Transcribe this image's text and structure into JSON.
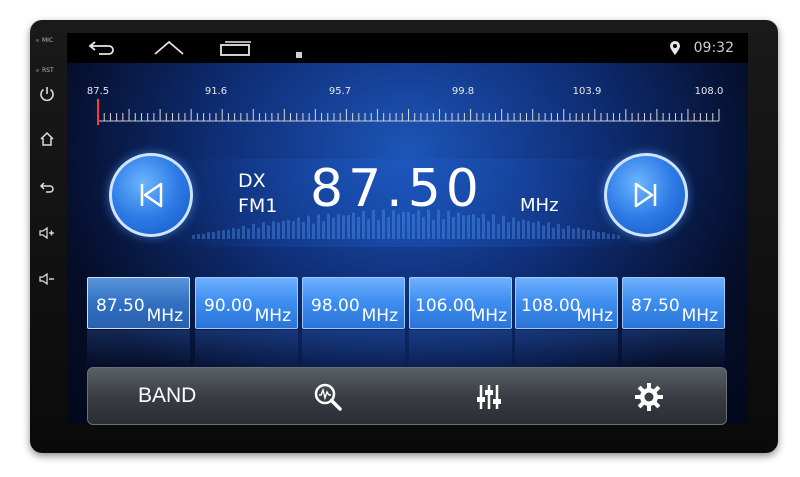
{
  "bezel": {
    "mic_label": "MIC",
    "rst_label": "RST"
  },
  "status_bar": {
    "time": "09:32",
    "icons": [
      "back-icon",
      "home-icon",
      "recent-apps-icon",
      "notification-icon",
      "location-icon"
    ]
  },
  "tuner_scale": {
    "labels": [
      "87.5",
      "91.6",
      "95.7",
      "99.8",
      "103.9",
      "108.0"
    ],
    "current_marker": 87.5
  },
  "display": {
    "mode": "DX",
    "band": "FM1",
    "frequency": "87.50",
    "unit": "MHz"
  },
  "presets": [
    {
      "value": "87.50",
      "unit": "MHz",
      "active": true
    },
    {
      "value": "90.00",
      "unit": "MHz",
      "active": false
    },
    {
      "value": "98.00",
      "unit": "MHz",
      "active": false
    },
    {
      "value": "106.00",
      "unit": "MHz",
      "active": false
    },
    {
      "value": "108.00",
      "unit": "MHz",
      "active": false
    },
    {
      "value": "87.50",
      "unit": "MHz",
      "active": false
    }
  ],
  "bottom_bar": {
    "band_label": "BAND",
    "icons": [
      "search-icon",
      "equalizer-icon",
      "settings-icon"
    ]
  },
  "colors": {
    "accent": "#3f8ff0",
    "screen_bg": "#0f2f78"
  }
}
